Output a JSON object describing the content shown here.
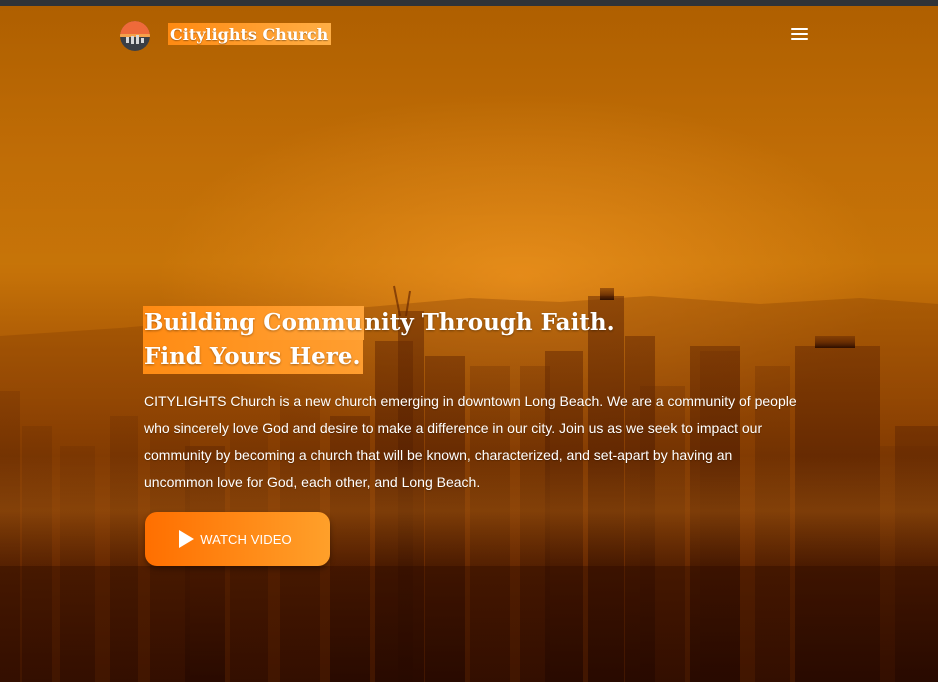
{
  "brand": {
    "name": "Citylights Church",
    "logo_icon": "sunset-city-logo-icon"
  },
  "nav": {
    "menu_icon": "hamburger-menu-icon"
  },
  "hero": {
    "headline_line1_highlight": "Building Commu",
    "headline_line1_rest": "nity Through Faith.",
    "headline_line2": "Find Yours Here.",
    "description": "CITYLIGHTS Church is a new church emerging in downtown Long Beach. We are a community of people who sincerely love God and desire to make a difference in our city. Join us as we seek to impact our community by becoming a church that will be known, characterized, and set-apart by having an uncommon love for God, each other, and Long Beach.",
    "watch_button_label": "WATCH VIDEO",
    "watch_button_icon": "play-icon",
    "background": "city-skyline-sunset"
  },
  "colors": {
    "accent": "#ff8a12",
    "accent_light": "#ffa43a",
    "text": "#ffffff",
    "top_strip": "#2f3338"
  }
}
